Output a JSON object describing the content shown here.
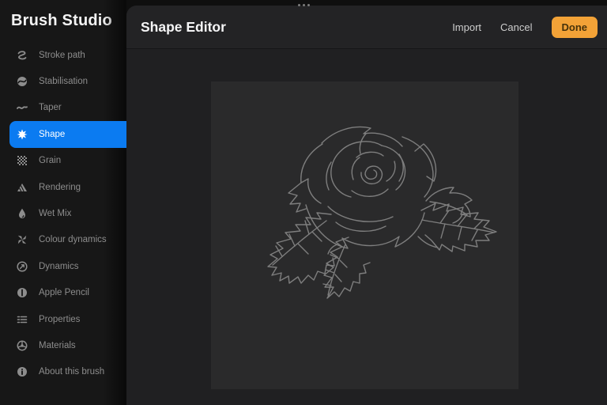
{
  "window": {
    "drag_handle_icon": "ellipsis-drag-dots"
  },
  "sidebar": {
    "title": "Brush Studio",
    "items": [
      {
        "label": "Stroke path",
        "icon": "stroke-path-icon",
        "selected": false
      },
      {
        "label": "Stabilisation",
        "icon": "stabilisation-icon",
        "selected": false
      },
      {
        "label": "Taper",
        "icon": "taper-icon",
        "selected": false
      },
      {
        "label": "Shape",
        "icon": "shape-icon",
        "selected": true
      },
      {
        "label": "Grain",
        "icon": "grain-icon",
        "selected": false
      },
      {
        "label": "Rendering",
        "icon": "rendering-icon",
        "selected": false
      },
      {
        "label": "Wet Mix",
        "icon": "wet-mix-icon",
        "selected": false
      },
      {
        "label": "Colour dynamics",
        "icon": "colour-dynamics-icon",
        "selected": false
      },
      {
        "label": "Dynamics",
        "icon": "dynamics-icon",
        "selected": false
      },
      {
        "label": "Apple Pencil",
        "icon": "apple-pencil-icon",
        "selected": false
      },
      {
        "label": "Properties",
        "icon": "properties-icon",
        "selected": false
      },
      {
        "label": "Materials",
        "icon": "materials-icon",
        "selected": false
      },
      {
        "label": "About this brush",
        "icon": "about-icon",
        "selected": false
      }
    ]
  },
  "editor": {
    "title": "Shape Editor",
    "actions": {
      "import_label": "Import",
      "cancel_label": "Cancel",
      "done_label": "Done"
    },
    "canvas": {
      "content": "rose line drawing shape source"
    }
  },
  "colors": {
    "accent_blue": "#0b7bf1",
    "done_orange": "#f2a237",
    "canvas_bg": "#2a2a2b",
    "line_art_gray": "#7e7e7e",
    "sidebar_bg": "#171717",
    "panel_bg": "#202022"
  }
}
